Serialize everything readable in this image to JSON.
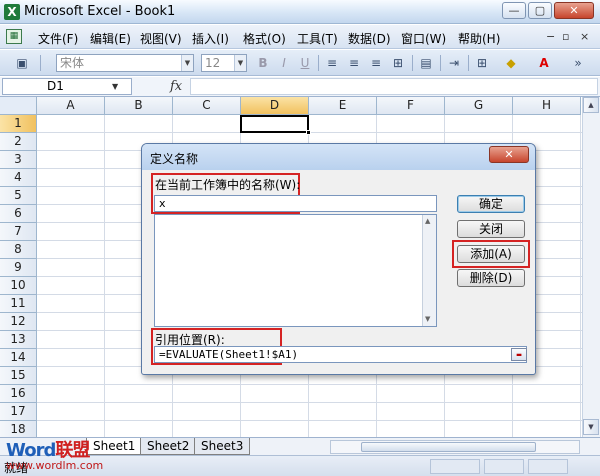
{
  "window": {
    "title": "Microsoft Excel - Book1",
    "app_icon": "X"
  },
  "window_buttons": {
    "minimize": "—",
    "restore": "▢",
    "close": "✕"
  },
  "menu": {
    "items": [
      "文件(F)",
      "编辑(E)",
      "视图(V)",
      "插入(I)",
      "格式(O)",
      "工具(T)",
      "数据(D)",
      "窗口(W)",
      "帮助(H)"
    ],
    "doc_minimize": "−",
    "doc_restore": "▫",
    "doc_close": "×"
  },
  "toolbar": {
    "font_name": "宋体",
    "font_size": "12",
    "bold": "B",
    "italic": "I",
    "underline": "U",
    "dropdown_arrow": "▼"
  },
  "formula_bar": {
    "name_box": "D1",
    "name_box_arrow": "▼",
    "fx": "fx",
    "formula": ""
  },
  "grid": {
    "columns": [
      "A",
      "B",
      "C",
      "D",
      "E",
      "F",
      "G",
      "H"
    ],
    "rows": [
      "1",
      "2",
      "3",
      "4",
      "5",
      "6",
      "7",
      "8",
      "9",
      "10",
      "11",
      "12",
      "13",
      "14",
      "15",
      "16",
      "17",
      "18"
    ],
    "selected_column": "D",
    "selected_row": "1"
  },
  "sheets": {
    "tabs": [
      "Sheet1",
      "Sheet2",
      "Sheet3"
    ],
    "active": "Sheet1"
  },
  "status": {
    "text": "就绪"
  },
  "watermark": {
    "logo_prefix": "Word",
    "logo_suffix": "联盟",
    "url": "www.wordlm.com"
  },
  "dialog": {
    "title": "定义名称",
    "close": "✕",
    "name_label": "在当前工作簿中的名称(W):",
    "name_value": "x",
    "ref_label": "引用位置(R):",
    "ref_value": "=EVALUATE(Sheet1!$A1)",
    "buttons": {
      "ok": "确定",
      "close": "关闭",
      "add": "添加(A)",
      "delete": "删除(D)"
    }
  },
  "colors": {
    "highlight": "#d52323",
    "title_gradient_top": "#d4e4f7"
  }
}
